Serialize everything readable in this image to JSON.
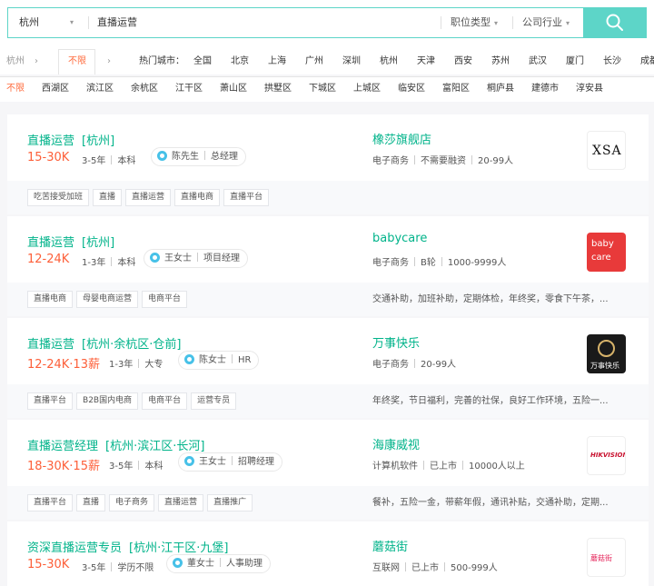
{
  "search": {
    "city": "杭州",
    "keyword": "直播运营",
    "position_type": "职位类型",
    "industry": "公司行业"
  },
  "city_filter": {
    "current": "杭州",
    "selected": "不限",
    "hot_label": "热门城市：",
    "cities": [
      "全国",
      "北京",
      "上海",
      "广州",
      "深圳",
      "杭州",
      "天津",
      "西安",
      "苏州",
      "武汉",
      "厦门",
      "长沙",
      "成都"
    ]
  },
  "districts": [
    "不限",
    "西湖区",
    "滨江区",
    "余杭区",
    "江干区",
    "萧山区",
    "拱墅区",
    "下城区",
    "上城区",
    "临安区",
    "富阳区",
    "桐庐县",
    "建德市",
    "淳安县"
  ],
  "jobs": [
    {
      "title": "直播运营",
      "location": "[杭州]",
      "salary": "15-30K",
      "experience": "3-5年",
      "education": "本科",
      "recruiter": "陈先生",
      "recruiter_role": "总经理",
      "company": "橡莎旗舰店",
      "industry": "电子商务",
      "funding": "不需要融资",
      "size": "20-99人",
      "logo_text": "XSA",
      "tags": [
        "吃苦接受加班",
        "直播",
        "直播运营",
        "直播电商",
        "直播平台"
      ],
      "benefits": ""
    },
    {
      "title": "直播运营",
      "location": "[杭州]",
      "salary": "12-24K",
      "experience": "1-3年",
      "education": "本科",
      "recruiter": "王女士",
      "recruiter_role": "项目经理",
      "company": "babycare",
      "industry": "电子商务",
      "funding": "B轮",
      "size": "1000-9999人",
      "logo_text_1": "baby",
      "logo_text_2": "care",
      "tags": [
        "直播电商",
        "母婴电商运营",
        "电商平台"
      ],
      "benefits": "交通补助，加班补助，定期体检，年终奖，零食下午茶，..."
    },
    {
      "title": "直播运营",
      "location": "[杭州·余杭区·仓前]",
      "salary": "12-24K·13薪",
      "experience": "1-3年",
      "education": "大专",
      "recruiter": "陈女士",
      "recruiter_role": "HR",
      "company": "万事快乐",
      "industry": "电子商务",
      "size": "20-99人",
      "logo_text": "万事快乐",
      "tags": [
        "直播平台",
        "B2B国内电商",
        "电商平台",
        "运营专员"
      ],
      "benefits": "年终奖，节日福利，完善的社保，良好工作环境，五险一..."
    },
    {
      "title": "直播运营经理",
      "location": "[杭州·滨江区·长河]",
      "salary": "18-30K·15薪",
      "experience": "3-5年",
      "education": "本科",
      "recruiter": "王女士",
      "recruiter_role": "招聘经理",
      "company": "海康威视",
      "industry": "计算机软件",
      "funding": "已上市",
      "size": "10000人以上",
      "logo_text": "HIKVISION",
      "tags": [
        "直播平台",
        "直播",
        "电子商务",
        "直播运营",
        "直播推广"
      ],
      "benefits": "餐补，五险一金，带薪年假，通讯补贴，交通补助，定期..."
    },
    {
      "title": "资深直播运营专员",
      "location": "[杭州·江干区·九堡]",
      "salary": "15-30K",
      "experience": "3-5年",
      "education": "学历不限",
      "recruiter": "董女士",
      "recruiter_role": "人事助理",
      "company": "蘑菇街",
      "industry": "互联网",
      "funding": "已上市",
      "size": "500-999人",
      "logo_text": "蘑菇街",
      "tags": [],
      "benefits": ""
    }
  ],
  "colors": {
    "accent": "#5dd5c8",
    "green": "#00b38a",
    "orange": "#fd5f39"
  }
}
